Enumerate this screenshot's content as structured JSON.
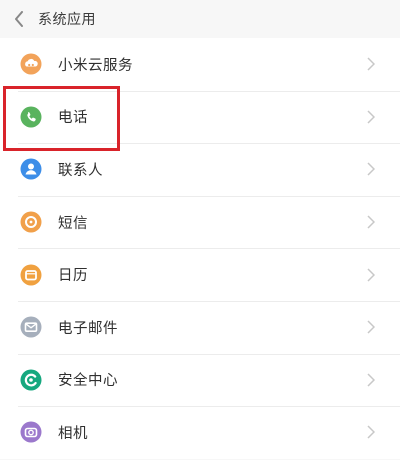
{
  "header": {
    "title": "系统应用",
    "back_icon": "chevron-left-icon"
  },
  "list": {
    "items": [
      {
        "id": "mi-cloud",
        "label": "小米云服务",
        "icon": "cloud-icon",
        "color": "#f2a35a"
      },
      {
        "id": "phone",
        "label": "电话",
        "icon": "phone-icon",
        "color": "#59b35e"
      },
      {
        "id": "contacts",
        "label": "联系人",
        "icon": "contacts-icon",
        "color": "#3d8ee8"
      },
      {
        "id": "sms",
        "label": "短信",
        "icon": "message-icon",
        "color": "#f1a04a"
      },
      {
        "id": "calendar",
        "label": "日历",
        "icon": "calendar-icon",
        "color": "#f0a140"
      },
      {
        "id": "email",
        "label": "电子邮件",
        "icon": "mail-icon",
        "color": "#a6afbc"
      },
      {
        "id": "security",
        "label": "安全中心",
        "icon": "shield-icon",
        "color": "#16a87f"
      },
      {
        "id": "camera",
        "label": "相机",
        "icon": "camera-icon",
        "color": "#9b78cc"
      }
    ]
  },
  "annotation": {
    "highlight_color": "#d9232a",
    "highlighted_item": "phone"
  }
}
